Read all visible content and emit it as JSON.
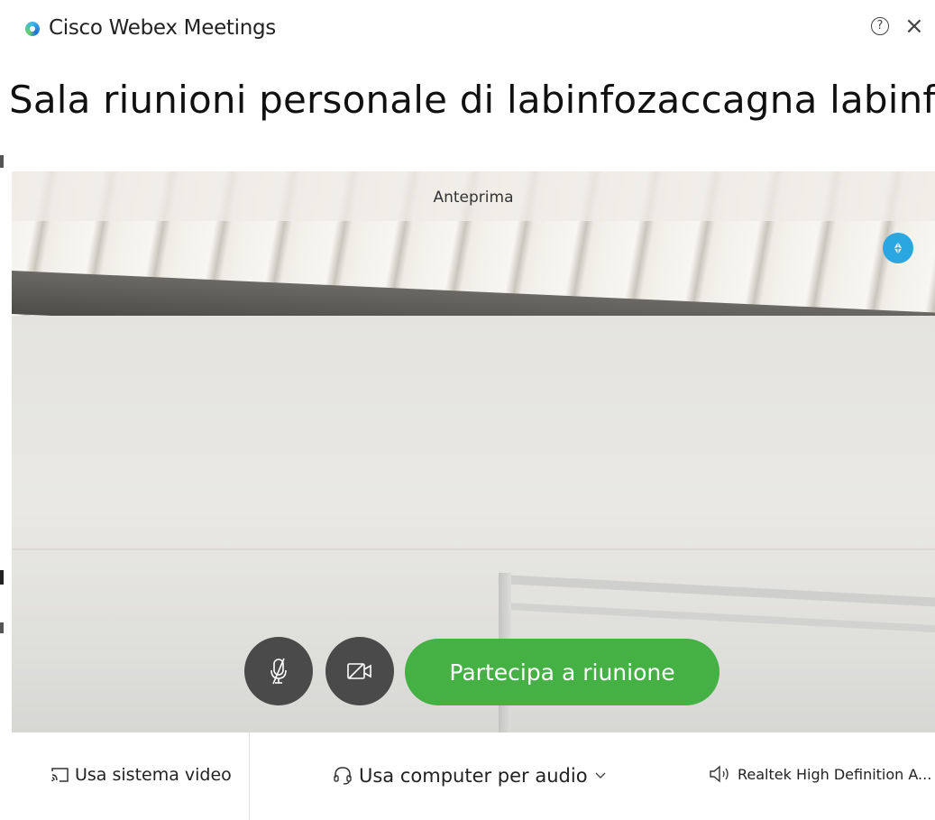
{
  "window": {
    "app_title": "Cisco Webex Meetings",
    "help_icon": "help-icon",
    "close_icon": "close-icon"
  },
  "meeting": {
    "title": "Sala riunioni personale di labinfozaccagna labinfozacca..."
  },
  "preview": {
    "label": "Anteprima",
    "pip_icon": "picture-in-picture-icon"
  },
  "controls": {
    "mute_icon": "mic-muted-icon",
    "video_icon": "video-off-icon",
    "join_label": "Partecipa a riunione",
    "join_color": "#45b145"
  },
  "bottom_bar": {
    "video_system_label": "Usa sistema video",
    "audio_label": "Usa computer per audio",
    "speaker_label": "Realtek High Definition A..."
  }
}
